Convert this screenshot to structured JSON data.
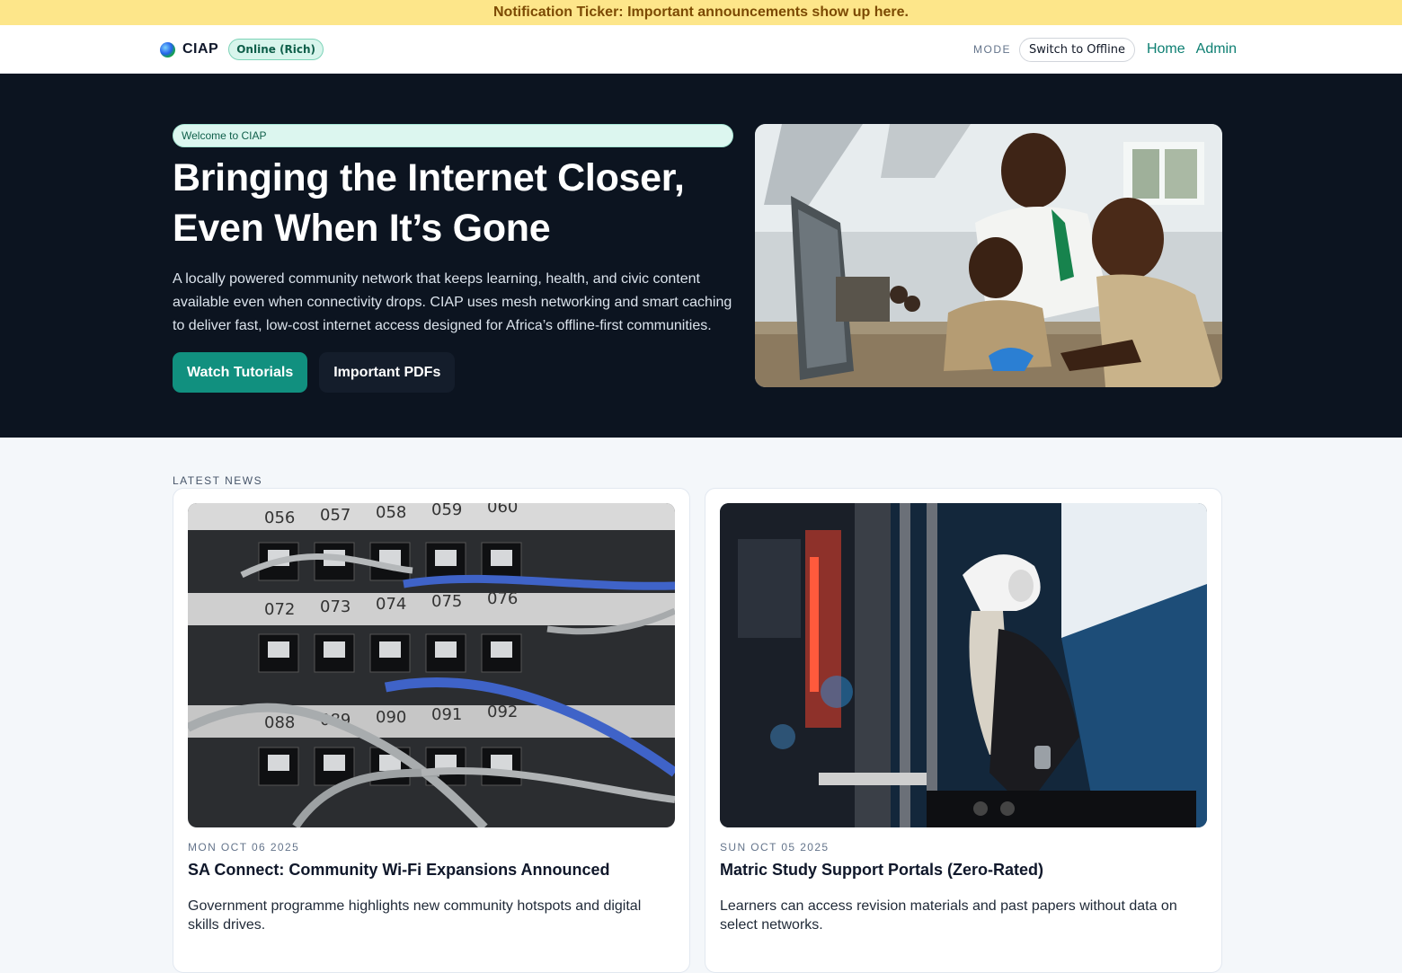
{
  "ticker": {
    "text": "Notification Ticker: Important announcements show up here."
  },
  "nav": {
    "brand": "CIAP",
    "status": "Online (Rich)",
    "mode_label": "MODE",
    "mode_button": "Switch to Offline",
    "links": [
      "Home",
      "Admin"
    ]
  },
  "hero": {
    "badge": "Welcome to CIAP",
    "title_line1": "Bringing the Internet Closer,",
    "title_line2": "Even When It’s Gone",
    "description": "A locally powered community network that keeps learning, health, and civic content available even when connectivity drops. CIAP uses mesh networking and smart caching to deliver fast, low-cost internet access designed for Africa’s offline-first communities.",
    "primary_button": "Watch Tutorials",
    "secondary_button": "Important PDFs"
  },
  "news": {
    "section_label": "LATEST NEWS",
    "items": [
      {
        "date": "MON OCT 06 2025",
        "title": "SA Connect: Community Wi-Fi Expansions Announced",
        "description": "Government programme highlights new community hotspots and digital skills drives.",
        "port_labels": [
          "056",
          "057",
          "058",
          "059",
          "060",
          "072",
          "073",
          "074",
          "075",
          "076",
          "088",
          "089",
          "090",
          "091",
          "092"
        ]
      },
      {
        "date": "SUN OCT 05 2025",
        "title": "Matric Study Support Portals (Zero-Rated)",
        "description": "Learners can access revision materials and past papers without data on select networks."
      }
    ]
  },
  "colors": {
    "ticker_bg": "#fde68a",
    "accent": "#11907f",
    "hero_bg": "#0c1420",
    "page_bg": "#f4f7fa"
  },
  "icons": {
    "brand": "globe-icon"
  }
}
